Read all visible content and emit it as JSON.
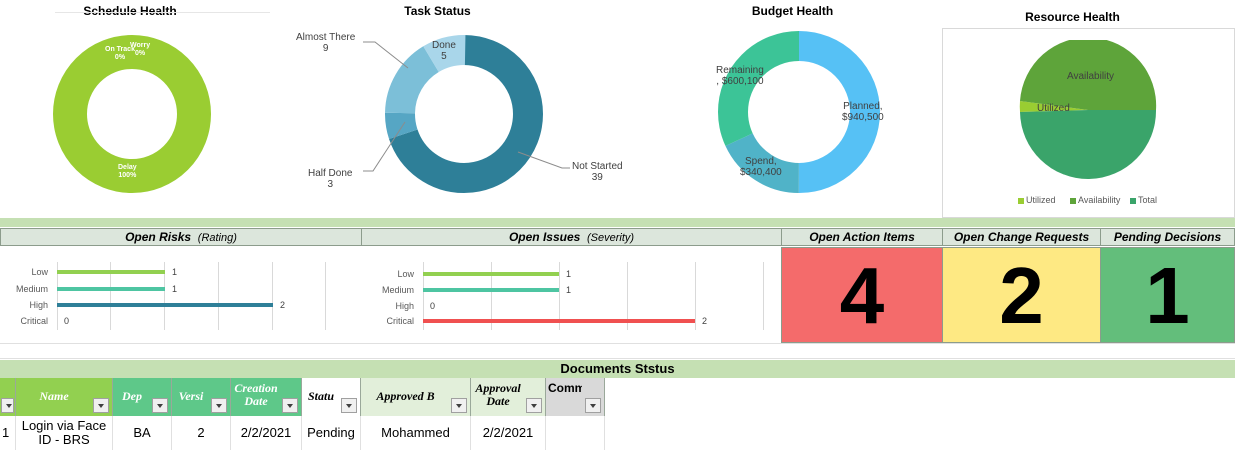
{
  "charts": {
    "schedule_health": {
      "title": "Schedule Health",
      "labels": {
        "worry": "Worry",
        "worry_pct": "0%",
        "on_track": "On Track",
        "on_track_pct": "0%",
        "delay": "Delay",
        "delay_pct": "100%"
      }
    },
    "task_status": {
      "title": "Task Status",
      "labels": {
        "almost_there": "Almost There",
        "almost_there_val": "9",
        "done": "Done",
        "done_val": "5",
        "half_done": "Half Done",
        "half_done_val": "3",
        "not_started": "Not Started",
        "not_started_val": "39"
      }
    },
    "budget_health": {
      "title": "Budget Health",
      "labels": {
        "remaining": "Remaining",
        "remaining_val": ", $600,100",
        "planned": "Planned,",
        "planned_val": "$940,500",
        "spend": "Spend,",
        "spend_val": "$340,400"
      }
    },
    "resource_health": {
      "title": "Resource Health",
      "labels": {
        "availability": "Availability",
        "utilized": "Utilized"
      },
      "legend": [
        "Utilized",
        "Availability",
        "Total"
      ]
    }
  },
  "chart_data": [
    {
      "type": "pie",
      "title": "Schedule Health",
      "categories": [
        "On Track",
        "Worry",
        "Delay"
      ],
      "values": [
        0,
        0,
        100
      ],
      "colors": [
        "#9acd32",
        "#9acd32",
        "#9acd32"
      ]
    },
    {
      "type": "pie",
      "title": "Task Status",
      "categories": [
        "Not Started",
        "Half Done",
        "Almost There",
        "Done"
      ],
      "values": [
        39,
        3,
        9,
        5
      ],
      "colors": [
        "#2e7f98",
        "#56a6c4",
        "#7cbfd8",
        "#a9d6ea"
      ]
    },
    {
      "type": "pie",
      "title": "Budget Health",
      "categories": [
        "Planned",
        "Spend",
        "Remaining"
      ],
      "values": [
        940500,
        340400,
        600100
      ],
      "colors": [
        "#56c1f5",
        "#50b3c8",
        "#3cc497"
      ]
    },
    {
      "type": "pie",
      "title": "Resource Health",
      "categories": [
        "Utilized",
        "Availability",
        "Total"
      ],
      "values": [
        2,
        48,
        50
      ],
      "colors": [
        "#9acd32",
        "#5ea43a",
        "#3aa46a"
      ],
      "legend": [
        "Utilized",
        "Availability",
        "Total"
      ]
    },
    {
      "type": "bar",
      "title": "Open Risks",
      "categories": [
        "Low",
        "Medium",
        "High",
        "Critical"
      ],
      "values": [
        1,
        1,
        2,
        0
      ],
      "colors": [
        "#92d050",
        "#4ec5a2",
        "#2e7f98",
        "#e34b4b"
      ]
    },
    {
      "type": "bar",
      "title": "Open Issues",
      "categories": [
        "Low",
        "Medium",
        "High",
        "Critical"
      ],
      "values": [
        1,
        1,
        0,
        2
      ],
      "colors": [
        "#92d050",
        "#4ec5a2",
        "#2e7f98",
        "#f05050"
      ]
    }
  ],
  "panels": {
    "open_risks": {
      "title": "Open Risks",
      "sub": "(Rating)"
    },
    "open_issues": {
      "title": "Open Issues",
      "sub": "(Severity)"
    },
    "open_action_items": {
      "title": "Open Action Items",
      "value": "4",
      "color": "#f46b6b"
    },
    "open_change_requests": {
      "title": "Open Change Requests",
      "value": "2",
      "color": "#fee983"
    },
    "pending_decisions": {
      "title": "Pending Decisions",
      "value": "1",
      "color": "#63be7b"
    }
  },
  "documents": {
    "title": "Documents Ststus",
    "headers": [
      "Name",
      "Dep",
      "Versi",
      "Creation Date",
      "Statu",
      "Approved B",
      "Approval Date",
      "Comments"
    ],
    "row": {
      "id": "1",
      "name": "Login via Face ID - BRS",
      "dep": "BA",
      "version": "2",
      "creation_date": "2/2/2021",
      "status": "Pending",
      "approved_by": "Mohammed",
      "approval_date": "2/2/2021",
      "comments": ""
    }
  }
}
